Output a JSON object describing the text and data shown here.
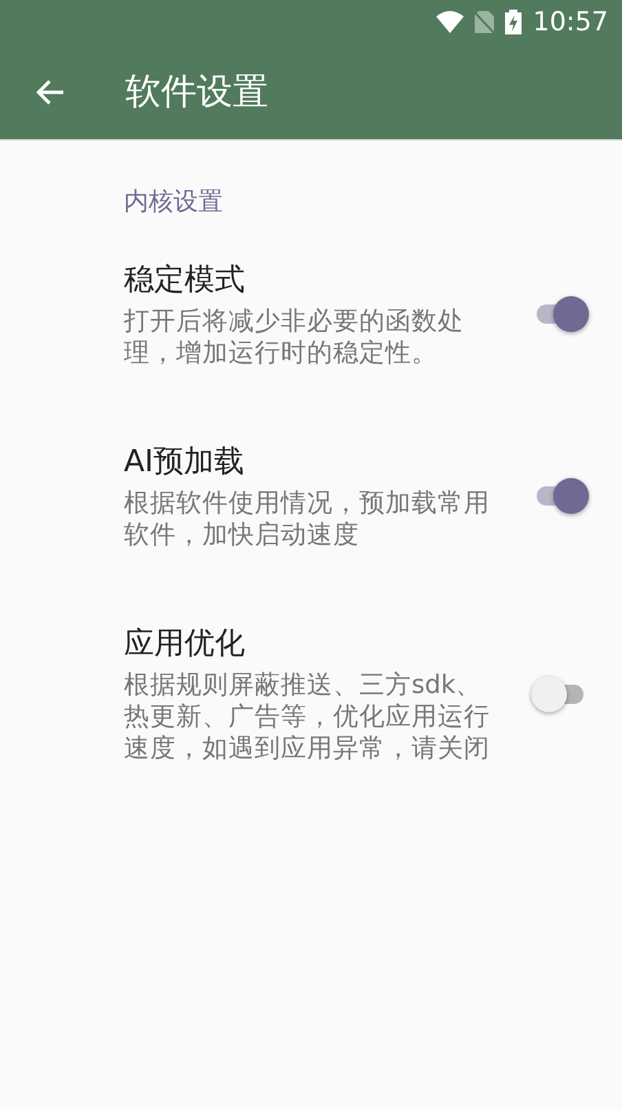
{
  "status_bar": {
    "time": "10:57"
  },
  "toolbar": {
    "title": "软件设置"
  },
  "section": {
    "title": "内核设置"
  },
  "settings": [
    {
      "title": "稳定模式",
      "summary": "打开后将减少非必要的函数处理，增加运行时的稳定性。",
      "on": true
    },
    {
      "title": "AI预加载",
      "summary": "根据软件使用情况，预加载常用软件，加快启动速度",
      "on": true
    },
    {
      "title": "应用优化",
      "summary": "根据规则屏蔽推送、三方sdk、热更新、广告等，优化应用运行速度，如遇到应用异常，请关闭",
      "on": false
    }
  ]
}
